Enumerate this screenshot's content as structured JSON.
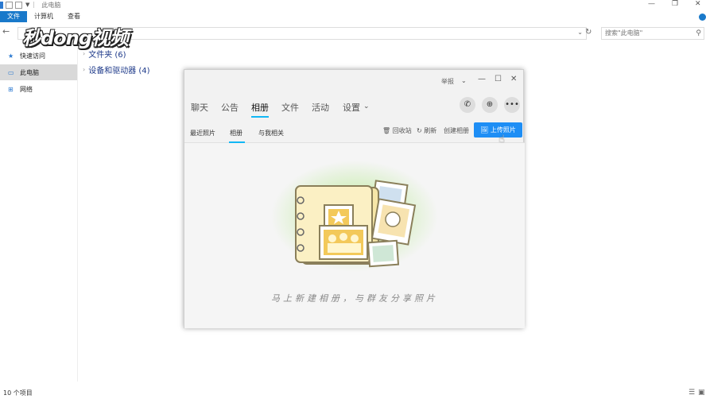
{
  "explorer": {
    "window_title": "此电脑",
    "ribbon_tabs": [
      "文件",
      "计算机",
      "查看"
    ],
    "search_placeholder": "搜索\"此电脑\"",
    "sidebar": [
      {
        "label": "快速访问",
        "icon": "star-icon"
      },
      {
        "label": "此电脑",
        "icon": "computer-icon",
        "selected": true
      },
      {
        "label": "网络",
        "icon": "network-icon"
      }
    ],
    "groups": [
      {
        "label": "文件夹 (6)"
      },
      {
        "label": "设备和驱动器 (4)"
      }
    ],
    "status_count": "10 个项目"
  },
  "watermark": {
    "text": "秒dong视频"
  },
  "qq": {
    "report_label": "举报",
    "tabs": [
      "聊天",
      "公告",
      "相册",
      "文件",
      "活动",
      "设置"
    ],
    "active_tab": "相册",
    "sub_tabs": [
      "最近照片",
      "相册",
      "与我相关"
    ],
    "active_sub_tab": "相册",
    "actions": {
      "recycle": "回收站",
      "refresh": "刷新",
      "create": "创建相册"
    },
    "upload_label": "上传照片",
    "empty_message": "马上新建相册，与群友分享照片",
    "accent_color": "#1e8ef5"
  }
}
